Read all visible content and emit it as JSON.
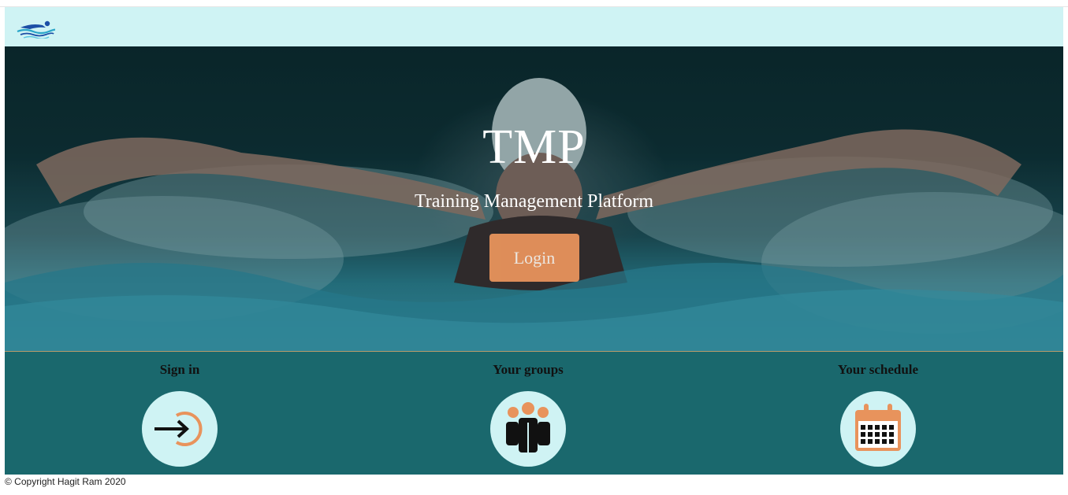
{
  "navbar": {
    "logo_icon": "swimmer-logo-icon"
  },
  "hero": {
    "title": "TMP",
    "subtitle": "Training Management Platform",
    "login_label": "Login",
    "background": "swimmer-butterfly-photo"
  },
  "features": [
    {
      "title": "Sign in",
      "icon": "sign-in-icon"
    },
    {
      "title": "Your groups",
      "icon": "group-icon"
    },
    {
      "title": "Your schedule",
      "icon": "calendar-icon"
    }
  ],
  "footer": {
    "copyright": "© Copyright Hagit Ram 2020"
  },
  "colors": {
    "navbar": "#cff3f4",
    "features_bg": "#1a686d",
    "accent": "#e8935c",
    "icon_circle": "#cff3f4"
  }
}
